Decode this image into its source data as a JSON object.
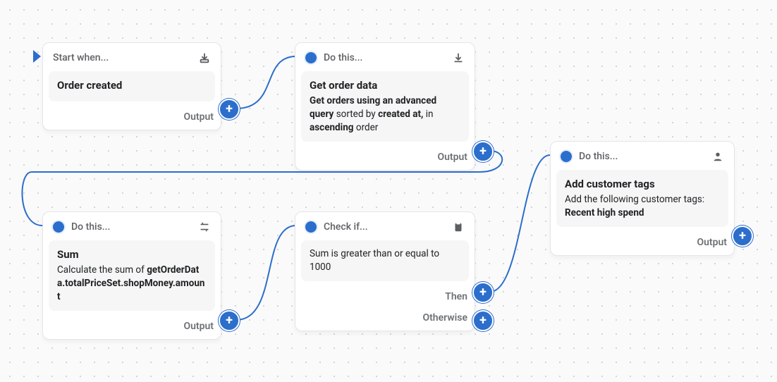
{
  "canvas": {
    "accent_color": "#2c6ecb",
    "bg_dot_color": "#d4d4d8"
  },
  "nodes": {
    "trigger": {
      "header_label": "Start when...",
      "header_icon": "import-icon",
      "title": "Order created",
      "output_label": "Output"
    },
    "get_order": {
      "header_label": "Do this...",
      "header_icon": "download-icon",
      "title": "Get order data",
      "desc_prefix": "Get orders using an advanced query",
      "desc_sorted_label": "sorted by",
      "desc_sorted_field": "created at,",
      "desc_in": "in",
      "desc_order": "ascending",
      "desc_suffix": "order",
      "output_label": "Output"
    },
    "sum": {
      "header_label": "Do this...",
      "header_icon": "configure-icon",
      "title": "Sum",
      "desc_prefix": "Calculate the sum of",
      "desc_field": "getOrderData.totalPriceSet.shopMoney.amount",
      "output_label": "Output"
    },
    "check": {
      "header_label": "Check if...",
      "header_icon": "clipboard-icon",
      "body_text": "Sum is greater than or equal to 1000",
      "then_label": "Then",
      "otherwise_label": "Otherwise"
    },
    "add_tags": {
      "header_label": "Do this...",
      "header_icon": "person-icon",
      "title": "Add customer tags",
      "desc_prefix": "Add the following customer tags:",
      "desc_tag": "Recent high spend",
      "output_label": "Output"
    }
  }
}
